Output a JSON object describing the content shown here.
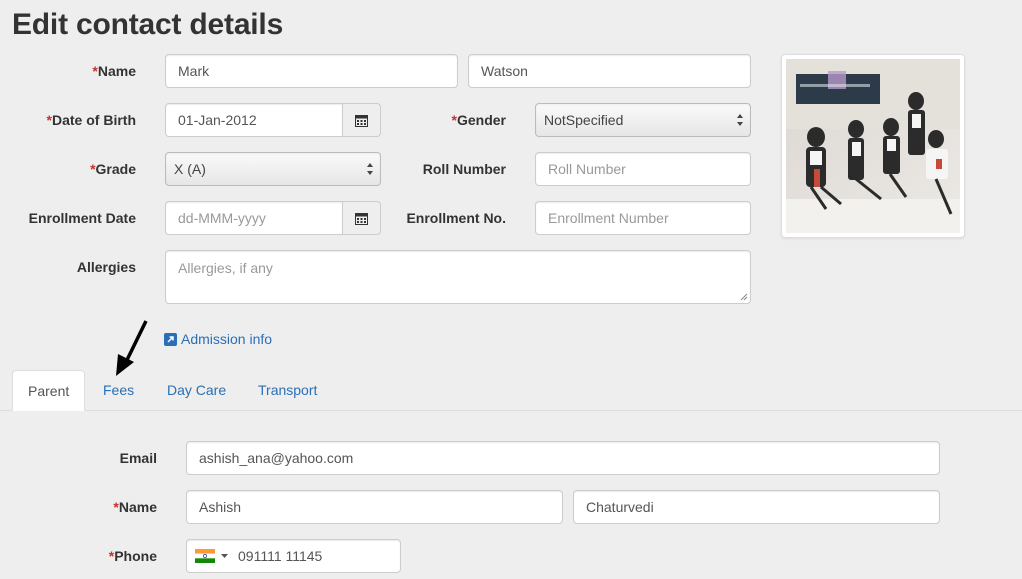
{
  "page": {
    "title": "Edit contact details"
  },
  "student": {
    "name_label": "Name",
    "first_name": "Mark",
    "last_name": "Watson",
    "dob_label": "Date of Birth",
    "dob": "01-Jan-2012",
    "gender_label": "Gender",
    "gender": "NotSpecified",
    "grade_label": "Grade",
    "grade": "X (A)",
    "roll_label": "Roll Number",
    "roll_placeholder": "Roll Number",
    "enroll_date_label": "Enrollment Date",
    "enroll_date_placeholder": "dd-MMM-yyyy",
    "enroll_no_label": "Enrollment No.",
    "enroll_no_placeholder": "Enrollment Number",
    "allergies_label": "Allergies",
    "allergies_placeholder": "Allergies, if any",
    "required_mark": "*"
  },
  "admission_link": "Admission info",
  "tabs": [
    {
      "label": "Parent",
      "active": true
    },
    {
      "label": "Fees",
      "active": false
    },
    {
      "label": "Day Care",
      "active": false
    },
    {
      "label": "Transport",
      "active": false
    }
  ],
  "parent": {
    "email_label": "Email",
    "email": "ashish_ana@yahoo.com",
    "name_label": "Name",
    "first_name": "Ashish",
    "last_name": "Chaturvedi",
    "phone_label": "Phone",
    "phone": "091111 11145"
  },
  "icons": {
    "calendar": "calendar-icon",
    "flag": "india-flag-icon",
    "external_link": "external-link-icon",
    "arrow": "annotation-arrow"
  },
  "colors": {
    "link": "#2a6fb6",
    "required": "#c9302c"
  }
}
